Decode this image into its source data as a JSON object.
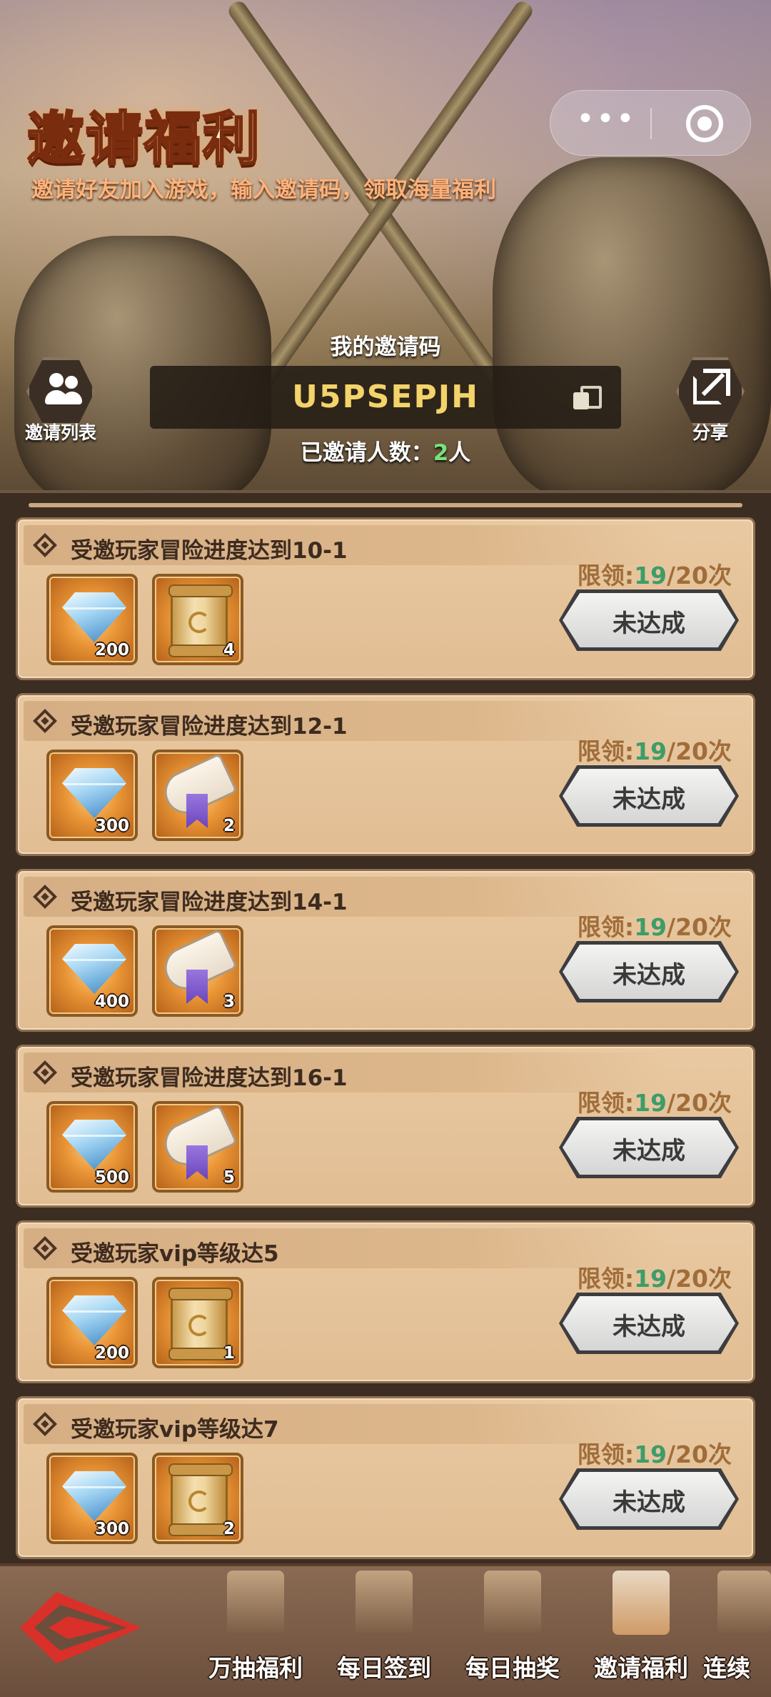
{
  "header": {
    "title": "邀请福利",
    "subtitle": "邀请好友加入游戏，输入邀请码，领取海量福利",
    "code_label": "我的邀请码",
    "invite_code": "U5PSEPJH",
    "invited_prefix": "已邀请人数：",
    "invited_count": "2",
    "invited_suffix": "人",
    "invite_list_label": "邀请列表",
    "share_label": "分享",
    "capsule_dots": "•••"
  },
  "tasks": [
    {
      "title": "受邀玩家冒险进度达到10-1",
      "limit_prefix": "限领:",
      "used": "19",
      "limit_suffix": "/20次",
      "status": "未达成",
      "rewards": [
        {
          "icon": "diamond-icon",
          "qty": "200"
        },
        {
          "icon": "gold-scroll-icon",
          "qty": "4"
        }
      ]
    },
    {
      "title": "受邀玩家冒险进度达到12-1",
      "limit_prefix": "限领:",
      "used": "19",
      "limit_suffix": "/20次",
      "status": "未达成",
      "rewards": [
        {
          "icon": "diamond-icon",
          "qty": "300"
        },
        {
          "icon": "purple-scroll-icon",
          "qty": "2"
        }
      ]
    },
    {
      "title": "受邀玩家冒险进度达到14-1",
      "limit_prefix": "限领:",
      "used": "19",
      "limit_suffix": "/20次",
      "status": "未达成",
      "rewards": [
        {
          "icon": "diamond-icon",
          "qty": "400"
        },
        {
          "icon": "purple-scroll-icon",
          "qty": "3"
        }
      ]
    },
    {
      "title": "受邀玩家冒险进度达到16-1",
      "limit_prefix": "限领:",
      "used": "19",
      "limit_suffix": "/20次",
      "status": "未达成",
      "rewards": [
        {
          "icon": "diamond-icon",
          "qty": "500"
        },
        {
          "icon": "purple-scroll-icon",
          "qty": "5"
        }
      ]
    },
    {
      "title": "受邀玩家vip等级达5",
      "limit_prefix": "限领:",
      "used": "19",
      "limit_suffix": "/20次",
      "status": "未达成",
      "rewards": [
        {
          "icon": "diamond-icon",
          "qty": "200"
        },
        {
          "icon": "gold-scroll-icon",
          "qty": "1"
        }
      ]
    },
    {
      "title": "受邀玩家vip等级达7",
      "limit_prefix": "限领:",
      "used": "19",
      "limit_suffix": "/20次",
      "status": "未达成",
      "rewards": [
        {
          "icon": "diamond-icon",
          "qty": "300"
        },
        {
          "icon": "gold-scroll-icon",
          "qty": "2"
        }
      ]
    }
  ],
  "bottom_nav": {
    "items": [
      {
        "label": "万抽福利",
        "icon": "cards-icon"
      },
      {
        "label": "每日签到",
        "icon": "signin-icon"
      },
      {
        "label": "每日抽奖",
        "icon": "lottery-icon"
      },
      {
        "label": "邀请福利",
        "icon": "handshake-icon"
      },
      {
        "label": "连续",
        "icon": "continuous-icon"
      }
    ],
    "active": "邀请福利"
  },
  "colors": {
    "accent_green": "#76e37a",
    "limit_used_green": "#3e9c69",
    "limit_text": "#a06d3a",
    "back_red": "#d9302a"
  }
}
